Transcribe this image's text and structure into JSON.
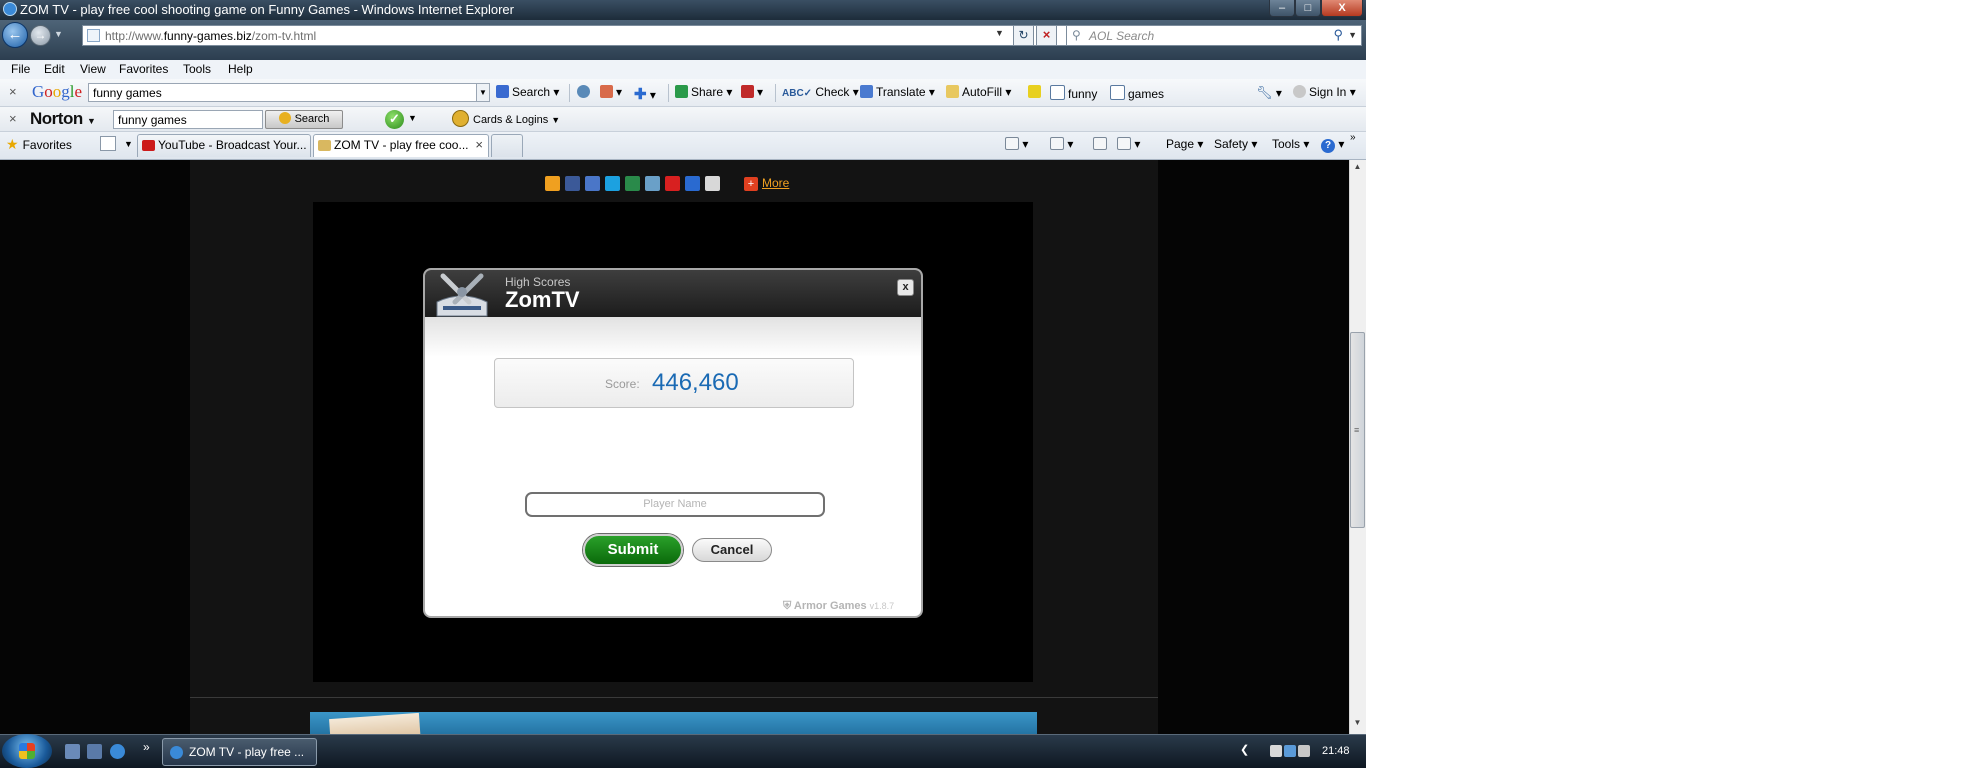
{
  "window": {
    "title": "ZOM TV - play free cool shooting game on Funny Games - Windows Internet Explorer",
    "btn_min": "–",
    "btn_max": "□",
    "btn_close": "X"
  },
  "address": {
    "url_prefix": "http://www.",
    "url_domain": "funny-games.biz",
    "url_path": "/zom-tv.html",
    "search_placeholder": "AOL Search"
  },
  "menu": [
    "File",
    "Edit",
    "View",
    "Favorites",
    "Tools",
    "Help"
  ],
  "google_toolbar": {
    "logo": "Google",
    "query": "funny games",
    "search": "Search",
    "share": "Share",
    "check": "Check",
    "translate": "Translate",
    "autofill": "AutoFill",
    "word1": "funny",
    "word2": "games",
    "sign_in": "Sign In"
  },
  "norton_toolbar": {
    "logo": "Norton",
    "query": "funny games",
    "search": "Search",
    "cards": "Cards & Logins"
  },
  "tabs": {
    "favorites": "Favorites",
    "items": [
      "YouTube - Broadcast Your...",
      "ZOM TV - play free coo..."
    ],
    "close": "×"
  },
  "command_bar": {
    "page": "Page",
    "safety": "Safety",
    "tools": "Tools"
  },
  "share": {
    "more": "More",
    "icon_colors": [
      "#f0a020",
      "#3b5998",
      "#4a76c8",
      "#1ca1e0",
      "#2a8a4a",
      "#6aa0c8",
      "#d82020",
      "#2a6ad0",
      "#d8d8d8"
    ]
  },
  "dialog": {
    "subtitle": "High Scores",
    "title": "ZomTV",
    "close": "x",
    "score_label": "Score:",
    "score_value": "446,460",
    "player_placeholder": "Player Name",
    "submit": "Submit",
    "cancel": "Cancel",
    "brand": "Armor Games",
    "version": "v1.8.7"
  },
  "taskbar": {
    "item": "ZOM TV - play free ...",
    "clock": "21:48"
  },
  "colors": {
    "score": "#1a6ab4",
    "submit": "#0a6a0a",
    "page_bg": "#050505"
  }
}
